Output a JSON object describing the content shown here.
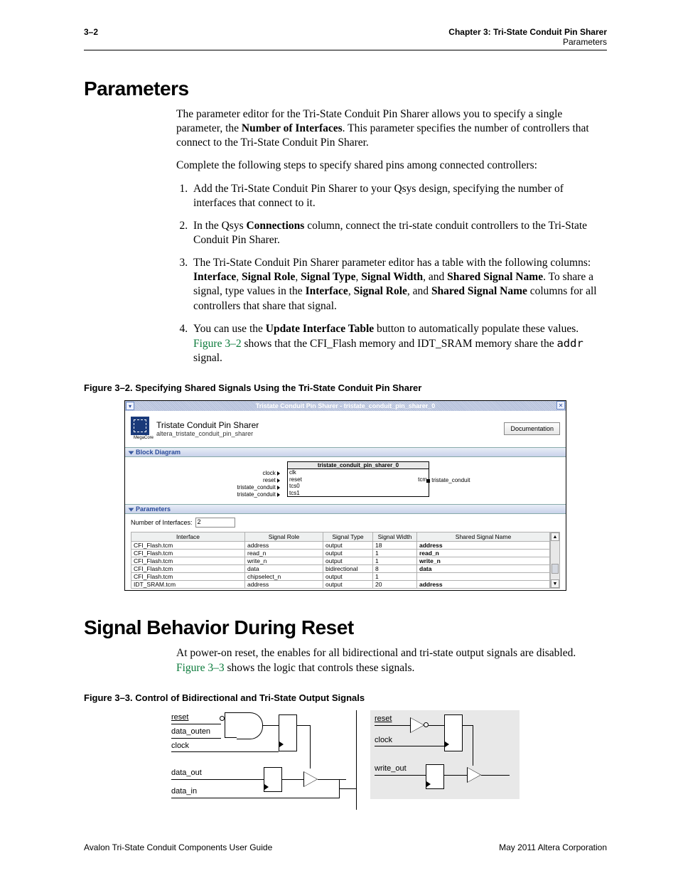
{
  "header": {
    "page_number": "3–2",
    "chapter_line": "Chapter 3:  Tri-State Conduit Pin Sharer",
    "sub_line": "Parameters"
  },
  "section1": {
    "title": "Parameters",
    "para1a": "The parameter editor for the Tri-State Conduit Pin Sharer allows you to specify a single parameter, the ",
    "para1b_bold": "Number of Interfaces",
    "para1c": ". This parameter specifies the number of controllers that connect to the Tri-State Conduit Pin Sharer.",
    "para2": "Complete the following steps to specify shared pins among connected controllers:",
    "step1": "Add the Tri-State Conduit Pin Sharer to your Qsys design, specifying the number of interfaces that connect to it.",
    "step2a": "In the Qsys ",
    "step2b_bold": "Connections",
    "step2c": " column, connect the tri-state conduit controllers to the Tri-State Conduit Pin Sharer.",
    "step3a": "The Tri-State Conduit Pin Sharer parameter editor has a table with the following columns: ",
    "step3_i": "Interface",
    "step3_s1": ", ",
    "step3_sr": "Signal Role",
    "step3_s2": ", ",
    "step3_st": "Signal Type",
    "step3_s3": ", ",
    "step3_sw": "Signal Width",
    "step3_s4": ", and ",
    "step3_ssn": "Shared Signal Name",
    "step3b": ". To share a signal, type values in the ",
    "step3b_i": "Interface",
    "step3b_s1": ", ",
    "step3b_sr": "Signal Role",
    "step3b_s2": ", and ",
    "step3b_ssn": "Shared Signal Name",
    "step3c": " columns for all controllers that share that signal.",
    "step4a": "You can use the ",
    "step4b_bold": "Update Interface Table",
    "step4c": " button to automatically populate these values. ",
    "step4d_link": "Figure 3–2",
    "step4e": " shows that the CFI_Flash memory and IDT_SRAM memory share the ",
    "step4f": "addr",
    "step4g": " signal."
  },
  "figure32": {
    "caption": "Figure 3–2.  Specifying Shared Signals Using the Tri-State Conduit Pin Sharer",
    "titlebar": "Tristate Conduit Pin Sharer - tristate_conduit_pin_sharer_0",
    "logo_caption": "MegaCore",
    "htitle": "Tristate Conduit Pin Sharer",
    "hsub": "altera_tristate_conduit_pin_sharer",
    "doc_btn": "Documentation",
    "block_diagram_label": "Block Diagram",
    "bd_title": "tristate_conduit_pin_sharer_0",
    "bd_left": {
      "clock": "clock",
      "reset": "reset",
      "tc": "tristate_conduit",
      "tc2": "tristate_conduit"
    },
    "bd_in": {
      "clk": "clk",
      "reset": "reset",
      "tcs0": "tcs0",
      "tcs1": "tcs1"
    },
    "bd_out_left": "tcm",
    "bd_out_right": "tristate_conduit",
    "params_label": "Parameters",
    "num_if_label": "Number of Interfaces:",
    "num_if_value": "2",
    "columns": [
      "Interface",
      "Signal Role",
      "Signal Type",
      "Signal Width",
      "Shared Signal Name"
    ],
    "rows": [
      {
        "if": "CFI_Flash.tcm",
        "role": "address",
        "type": "output",
        "width": "18",
        "ssn": "address"
      },
      {
        "if": "CFI_Flash.tcm",
        "role": "read_n",
        "type": "output",
        "width": "1",
        "ssn": "read_n"
      },
      {
        "if": "CFI_Flash.tcm",
        "role": "write_n",
        "type": "output",
        "width": "1",
        "ssn": "write_n"
      },
      {
        "if": "CFI_Flash.tcm",
        "role": "data",
        "type": "bidirectional",
        "width": "8",
        "ssn": "data"
      },
      {
        "if": "CFI_Flash.tcm",
        "role": "chipselect_n",
        "type": "output",
        "width": "1",
        "ssn": ""
      },
      {
        "if": "IDT_SRAM.tcm",
        "role": "address",
        "type": "output",
        "width": "20",
        "ssn": "address"
      }
    ]
  },
  "section2": {
    "title": "Signal Behavior During Reset",
    "para1a": "At power-on reset, the enables for all bidirectional and tri-state output signals are disabled. ",
    "para1b_link": "Figure 3–3",
    "para1c": " shows the logic that controls these signals."
  },
  "figure33": {
    "caption": "Figure 3–3.  Control of Bidirectional and Tri-State Output Signals",
    "left_labels": {
      "reset": "reset",
      "data_outen": "data_outen",
      "clock": "clock",
      "data_out": "data_out",
      "data_in": "data_in"
    },
    "right_labels": {
      "reset": "reset",
      "clock": "clock",
      "write_out": "write_out"
    }
  },
  "footer": {
    "left": "Avalon Tri-State Conduit Components User Guide",
    "right": "May 2011   Altera Corporation"
  }
}
